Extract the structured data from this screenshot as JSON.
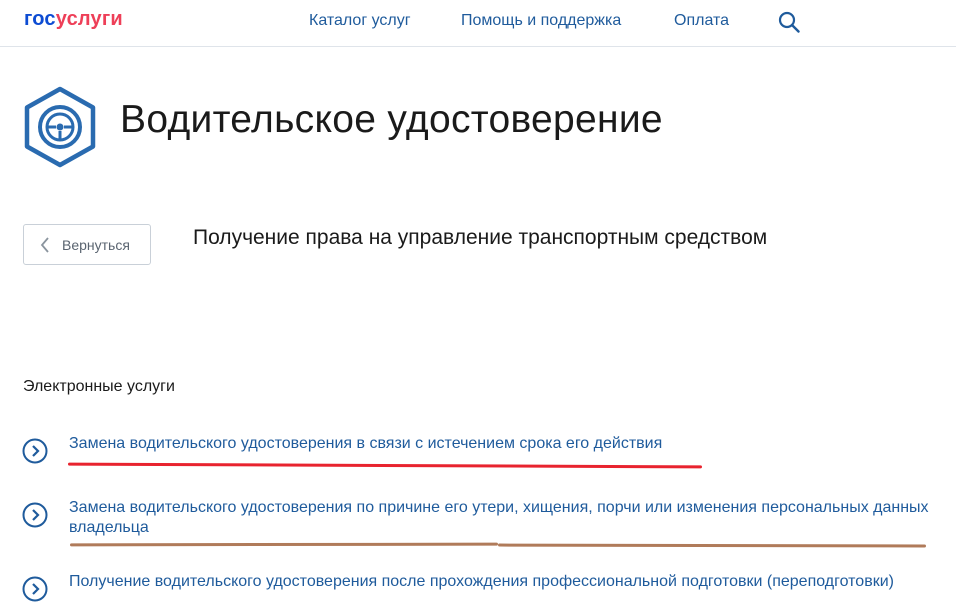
{
  "header": {
    "logo_part1": "гос",
    "logo_part2": "услуги",
    "nav": [
      "Каталог услуг",
      "Помощь и поддержка",
      "Оплата"
    ]
  },
  "page": {
    "title": "Водительское удостоверение",
    "back_label": "Вернуться",
    "subtitle": "Получение права на управление транспортным средством"
  },
  "services": {
    "heading": "Электронные услуги",
    "items": [
      {
        "label": "Замена водительского удостоверения в связи с истечением срока его действия"
      },
      {
        "label": "Замена водительского удостоверения по причине его утери, хищения, порчи или изменения персональных данных владельца"
      },
      {
        "label": "Получение водительского удостоверения после прохождения профессиональной подготовки (переподготовки)"
      }
    ]
  },
  "annotations": {
    "underline_red": "#e8232e",
    "underline_brown": "#b07b5a"
  },
  "colors": {
    "link": "#1f5b9c",
    "icon_blue": "#2a6bb0"
  }
}
